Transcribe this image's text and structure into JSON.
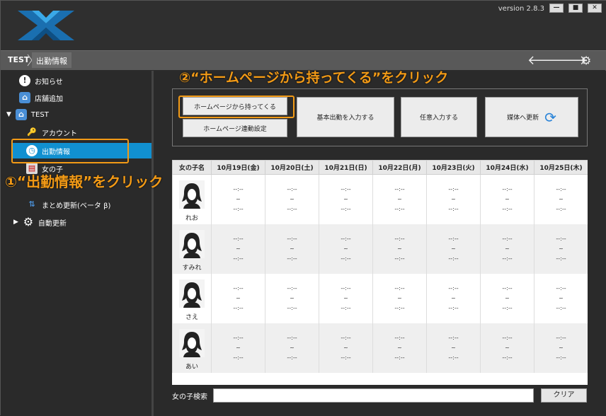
{
  "titlebar": {
    "version": "version 2.8.3",
    "min": "—",
    "max": "■",
    "close": "✕"
  },
  "breadcrumb": [
    "TEST",
    "出勤情報"
  ],
  "nav_icons": [
    "back-arrow-icon",
    "forward-arrow-icon",
    "gear-icon"
  ],
  "sidebar": {
    "items": [
      {
        "label": "お知らせ",
        "icon": "exclamation-icon"
      },
      {
        "label": "店舗追加",
        "icon": "home-add-icon"
      },
      {
        "label": "TEST",
        "icon": "home-icon"
      },
      {
        "label": "アカウント",
        "icon": "key-icon"
      },
      {
        "label": "出勤情報",
        "icon": "clock-icon"
      },
      {
        "label": "女の子",
        "icon": "document-icon"
      },
      {
        "label": "まとめ更新(ベータ β)",
        "icon": "upload-arrows-icon"
      },
      {
        "label": "自動更新",
        "icon": "gear-icon"
      }
    ],
    "active": "出勤情報"
  },
  "toolbar": {
    "fetch_homepage": "ホームページから持ってくる",
    "homepage_settings": "ホームページ連動設定",
    "basic_shift": "基本出勤を入力する",
    "manual_input": "任意入力する",
    "update_media": "媒体へ更新"
  },
  "table": {
    "headers": [
      "女の子名",
      "10月19日(金)",
      "10月20日(土)",
      "10月21日(日)",
      "10月22日(月)",
      "10月23日(火)",
      "10月24日(水)",
      "10月25日(木)"
    ],
    "girls": [
      "れお",
      "すみれ",
      "さえ",
      "あい"
    ],
    "empty_time": "--:--",
    "tilde": "~"
  },
  "search": {
    "label": "女の子検索",
    "placeholder": "",
    "clear": "クリア"
  },
  "callouts": {
    "step1": "①“出勤情報”をクリック",
    "step2": "②“ホームページから持ってくる”をクリック"
  },
  "colors": {
    "accent": "#1190d0",
    "callout": "#f29a16",
    "background": "#2a2a2a"
  }
}
